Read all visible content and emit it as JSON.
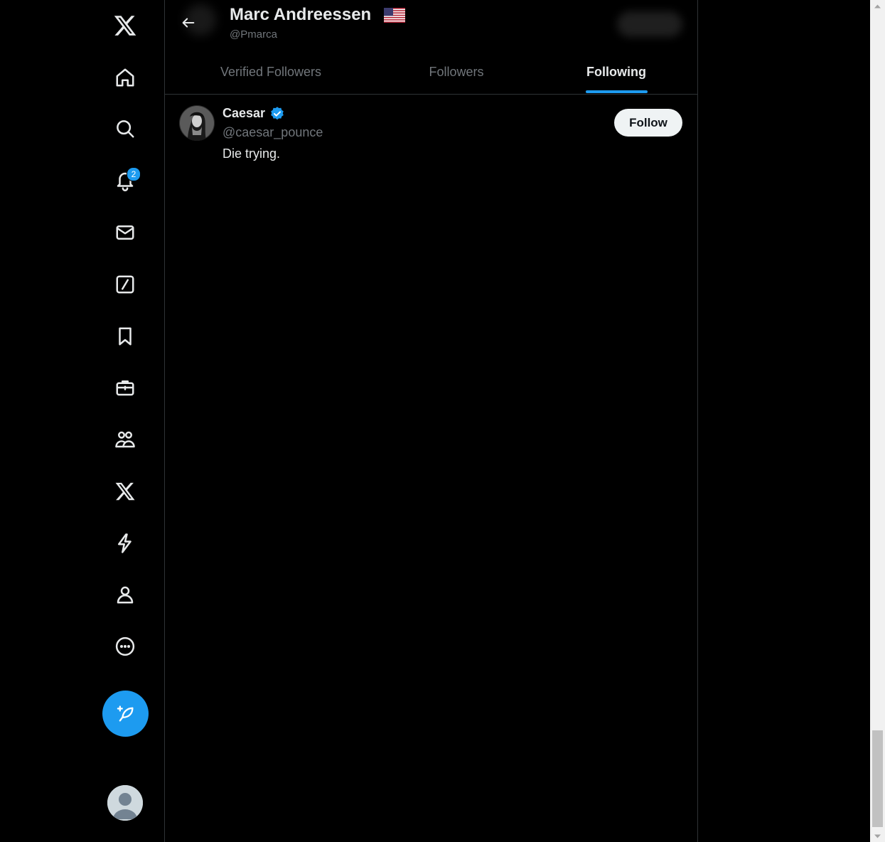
{
  "sidebar": {
    "items": [
      {
        "name": "x-logo",
        "label": "X"
      },
      {
        "name": "home",
        "label": "Home"
      },
      {
        "name": "explore",
        "label": "Explore"
      },
      {
        "name": "notifications",
        "label": "Notifications",
        "badge": "2"
      },
      {
        "name": "messages",
        "label": "Messages"
      },
      {
        "name": "grok",
        "label": "Grok"
      },
      {
        "name": "bookmarks",
        "label": "Bookmarks"
      },
      {
        "name": "jobs",
        "label": "Jobs"
      },
      {
        "name": "communities",
        "label": "Communities"
      },
      {
        "name": "premium",
        "label": "Premium"
      },
      {
        "name": "verified-orgs",
        "label": "Verified Orgs"
      },
      {
        "name": "profile",
        "label": "Profile"
      },
      {
        "name": "more",
        "label": "More"
      }
    ],
    "post_button_icon": "feather-plus-icon",
    "accent_color": "#1d9bf0"
  },
  "header": {
    "name": "Marc Andreessen",
    "handle": "@Pmarca",
    "flag_icon": "us-flag-icon",
    "tabs": [
      {
        "label": "Verified Followers",
        "active": false
      },
      {
        "label": "Followers",
        "active": false
      },
      {
        "label": "Following",
        "active": true
      }
    ]
  },
  "list": {
    "users": [
      {
        "name": "Caesar",
        "handle": "@caesar_pounce",
        "bio": "Die trying.",
        "verified": true,
        "follow_label": "Follow"
      }
    ]
  }
}
